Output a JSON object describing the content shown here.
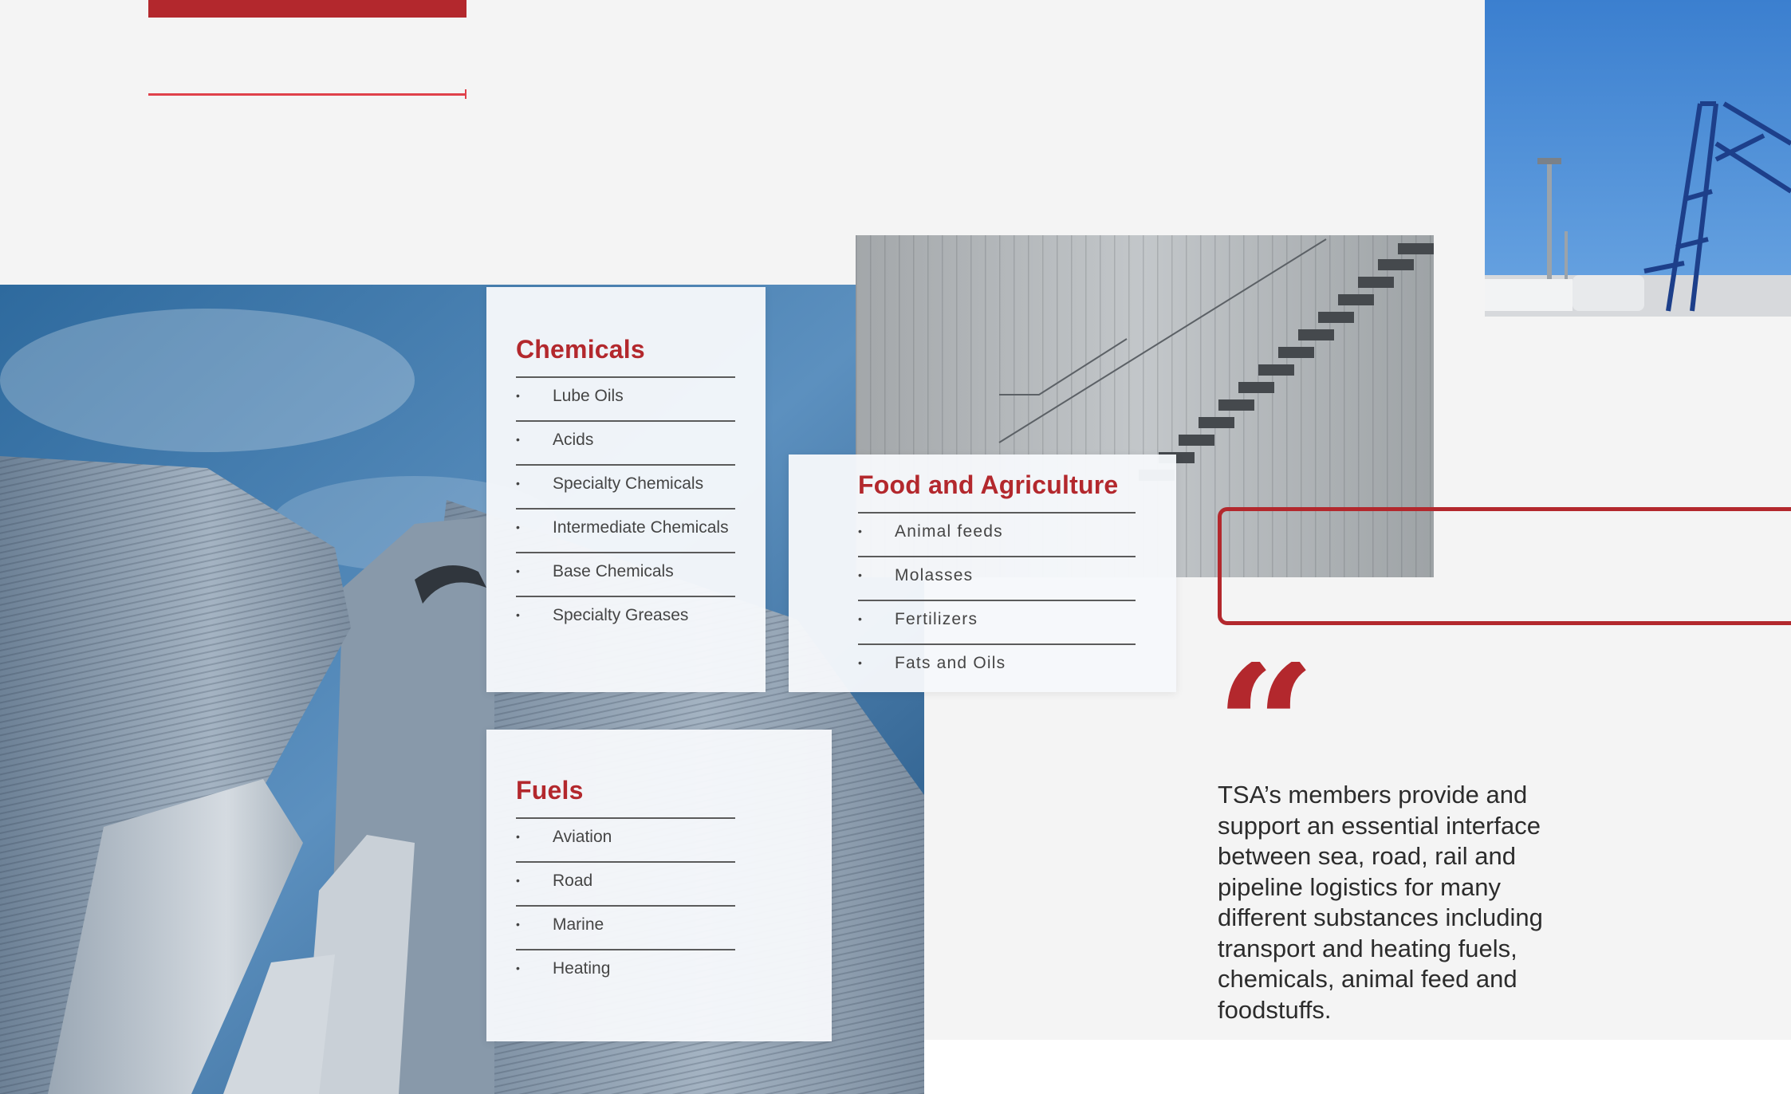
{
  "colors": {
    "accent": "#b3282d",
    "accent_light": "#e0414a",
    "background": "#f4f4f4",
    "text": "#2c2c2c"
  },
  "images": {
    "silos": "silos-photo",
    "stairs": "tank-stairs-photo",
    "crane": "loading-crane-photo"
  },
  "chemicals": {
    "title": "Chemicals",
    "items": [
      "Lube Oils",
      "Acids",
      "Specialty Chemicals",
      "Intermediate Chemicals",
      "Base Chemicals",
      "Specialty Greases"
    ]
  },
  "food": {
    "title": "Food and Agriculture",
    "items": [
      "Animal feeds",
      "Molasses",
      "Fertilizers",
      "Fats and Oils"
    ]
  },
  "fuels": {
    "title": "Fuels",
    "items": [
      "Aviation",
      "Road",
      "Marine",
      "Heating"
    ]
  },
  "quote": {
    "mark": "“",
    "text": "TSA’s members provide and support an essential interface between sea, road, rail and pipeline logistics for many different substances including transport and heating fuels, chemicals, animal feed and foodstuffs."
  }
}
